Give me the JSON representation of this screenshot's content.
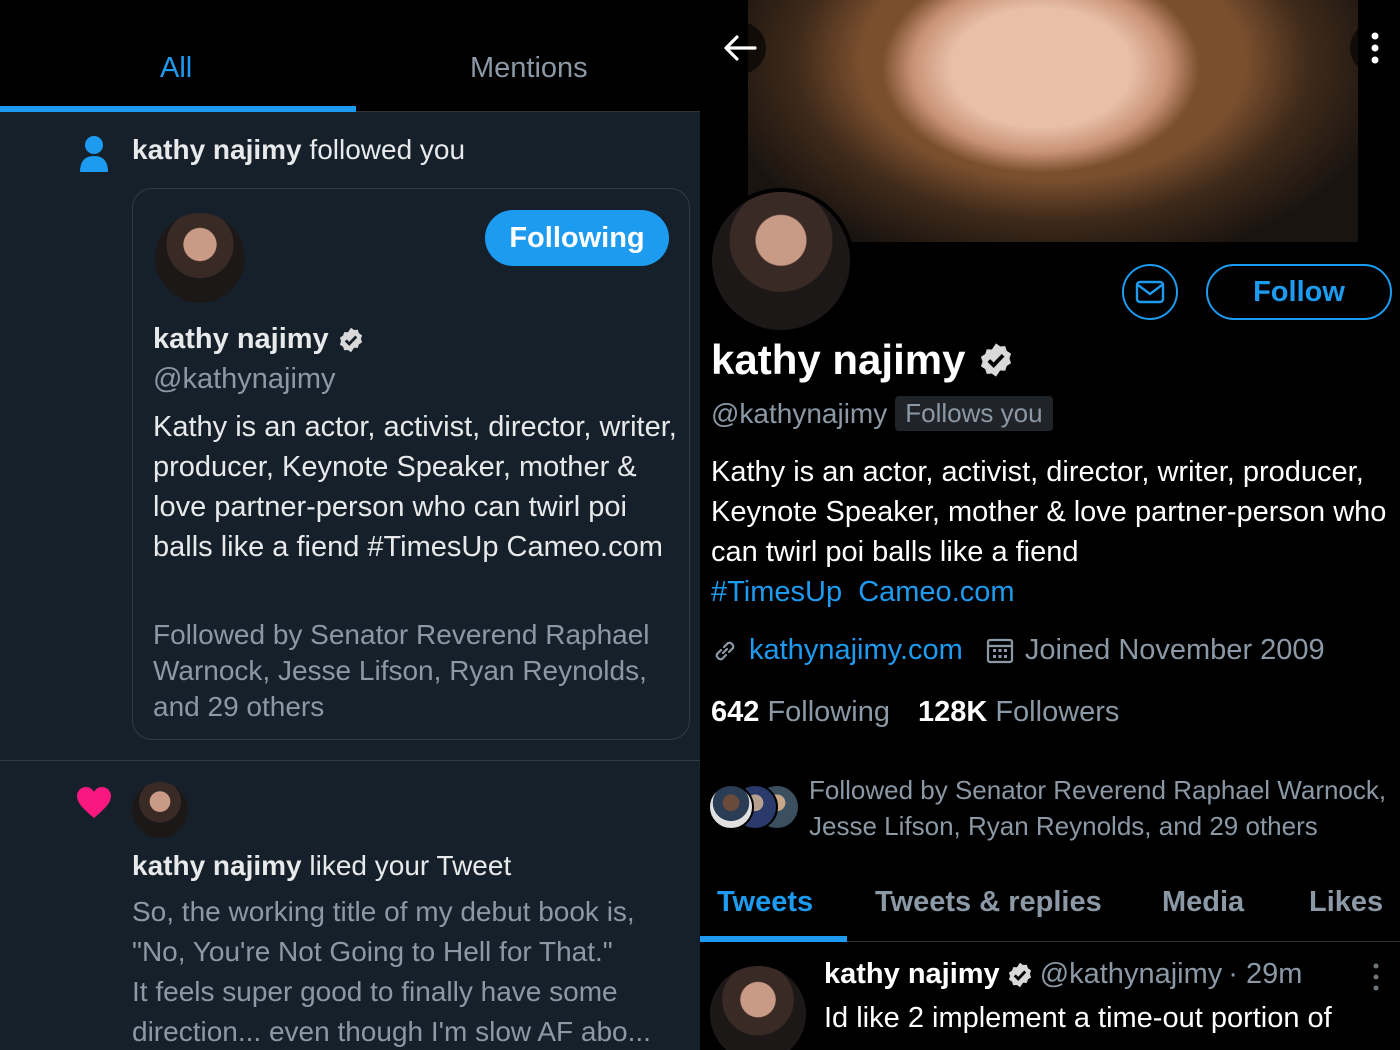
{
  "colors": {
    "accent": "#1d9bf0",
    "panel_left_bg": "#15202b",
    "panel_right_bg": "#000000",
    "heart": "#f91880",
    "muted": "#8b98a5"
  },
  "notifications_panel": {
    "tabs": [
      {
        "label": "All"
      },
      {
        "label": "Mentions"
      }
    ],
    "follow_notification": {
      "icon": "person-icon",
      "actor": "kathy najimy",
      "action": " followed you",
      "card": {
        "following_label": "Following",
        "name": "kathy najimy",
        "verified": true,
        "handle": "@kathynajimy",
        "bio": "Kathy is an actor, activist, director, writer, producer, Keynote Speaker, mother & love partner-person who can twirl poi balls like a fiend #TimesUp Cameo.com",
        "followed_by": "Followed by Senator Reverend Raphael Warnock, Jesse Lifson, Ryan Reynolds, and 29 others"
      }
    },
    "like_notification": {
      "icon": "heart-icon",
      "actor": "kathy najimy",
      "action": " liked your Tweet",
      "tweet_lines": [
        "So, the working title of my debut book is,",
        "\"No, You're Not Going to Hell for That.\"",
        "It feels super good to finally have some",
        "direction... even though I'm slow AF abo..."
      ]
    }
  },
  "profile_panel": {
    "follow_label": "Follow",
    "name": "kathy najimy",
    "verified": true,
    "handle": "@kathynajimy",
    "follows_you": "Follows you",
    "bio": "Kathy is an actor, activist, director, writer, producer, Keynote Speaker, mother & love partner-person who can twirl poi balls like a fiend",
    "bio_hashtag": "#TimesUp",
    "bio_link": "Cameo.com",
    "website": "kathynajimy.com",
    "joined": "Joined November 2009",
    "following_count": "642",
    "following_label": "Following",
    "followers_count": "128K",
    "followers_label": "Followers",
    "followed_by": "Followed by Senator Reverend Raphael Warnock, Jesse Lifson, Ryan Reynolds, and 29 others",
    "tabs": [
      {
        "label": "Tweets"
      },
      {
        "label": "Tweets & replies"
      },
      {
        "label": "Media"
      },
      {
        "label": "Likes"
      }
    ],
    "tweet": {
      "name": "kathy najimy",
      "handle": "@kathynajimy",
      "time": "· 29m",
      "text": "Id like 2 implement a time-out portion of"
    }
  }
}
